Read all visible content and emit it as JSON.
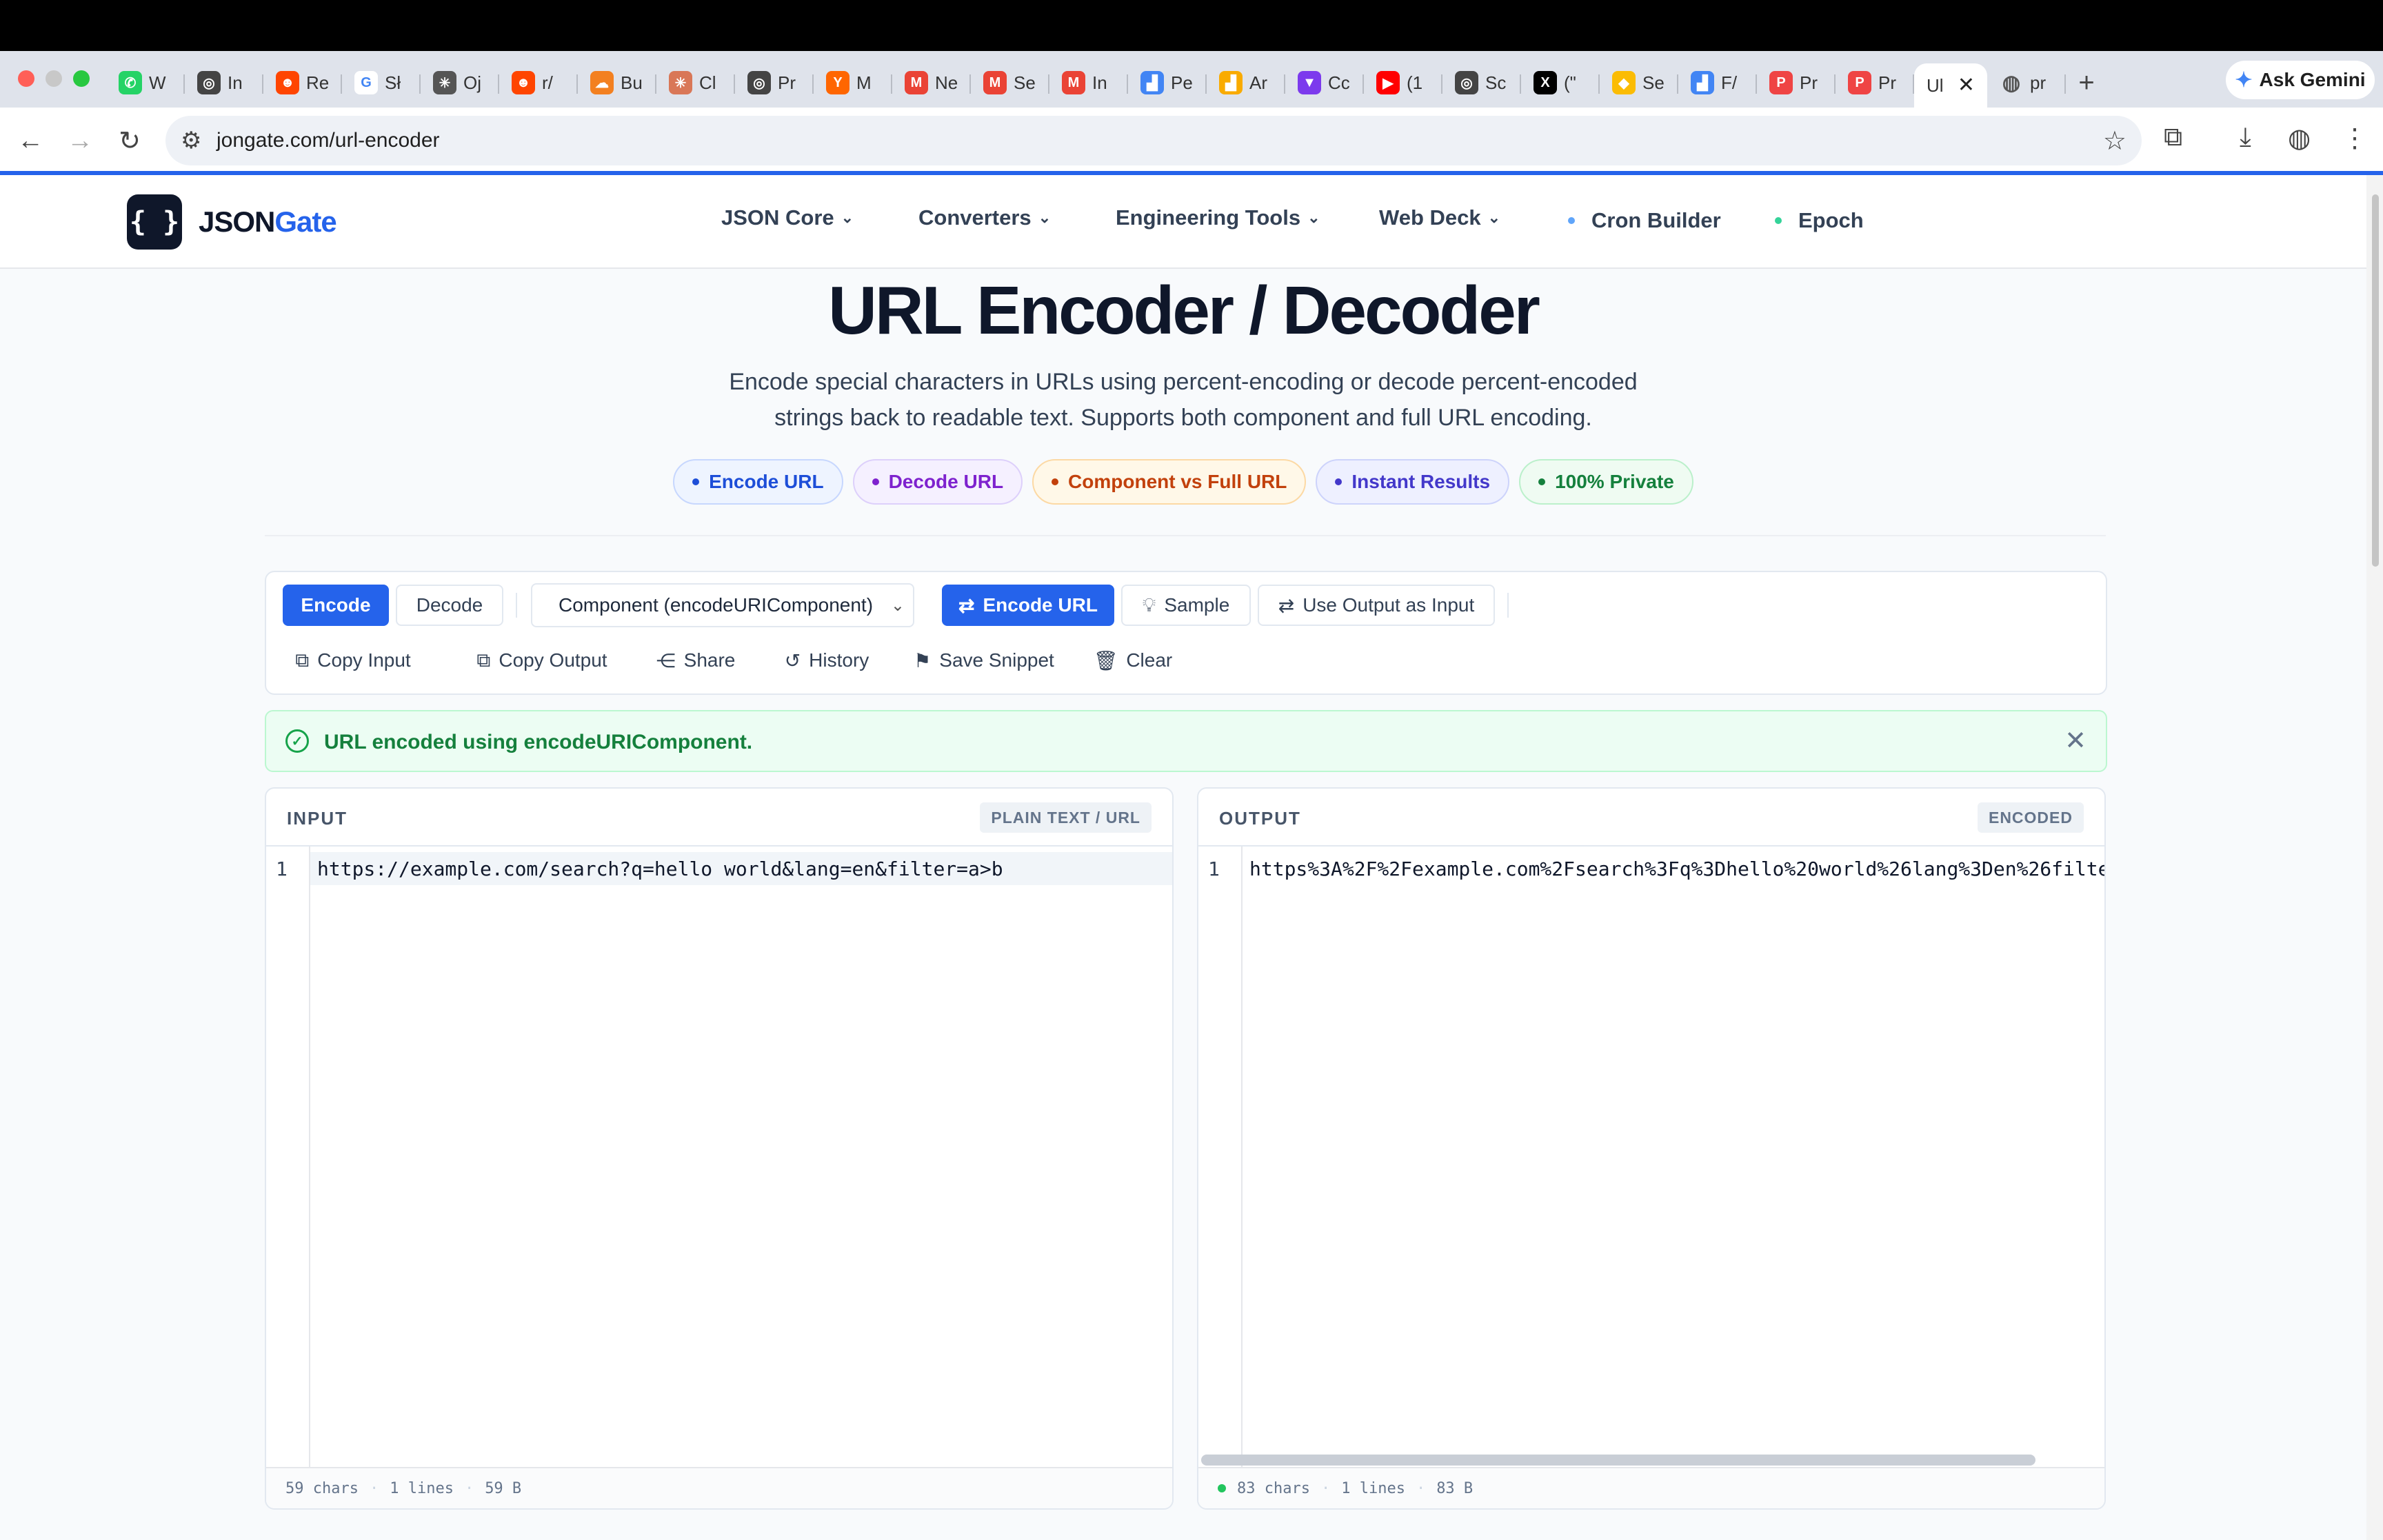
{
  "browser": {
    "tabs": [
      {
        "label": "W",
        "icon": "whatsapp-icon",
        "color": "#25d366",
        "glyph": "✆"
      },
      {
        "label": "In",
        "icon": "openai-icon",
        "color": "#444444",
        "glyph": "◎"
      },
      {
        "label": "Re",
        "icon": "reddit-icon",
        "color": "#ff4500",
        "glyph": "☻"
      },
      {
        "label": "Sł",
        "icon": "google-icon",
        "color": "#ffffff",
        "glyph": "G"
      },
      {
        "label": "Oj",
        "icon": "perplexity-icon",
        "color": "#555555",
        "glyph": "✳"
      },
      {
        "label": "r/",
        "icon": "reddit-icon",
        "color": "#ff4500",
        "glyph": "☻"
      },
      {
        "label": "Bu",
        "icon": "cloudflare-icon",
        "color": "#f38020",
        "glyph": "☁"
      },
      {
        "label": "Cl",
        "icon": "claude-icon",
        "color": "#d97757",
        "glyph": "✳"
      },
      {
        "label": "Pr",
        "icon": "openai-icon",
        "color": "#444444",
        "glyph": "◎"
      },
      {
        "label": "M",
        "icon": "ycombinator-icon",
        "color": "#ff6600",
        "glyph": "Y"
      },
      {
        "label": "Ne",
        "icon": "gmail-icon",
        "color": "#ea4335",
        "glyph": "M"
      },
      {
        "label": "Se",
        "icon": "gmail-icon",
        "color": "#ea4335",
        "glyph": "M"
      },
      {
        "label": "In",
        "icon": "gmail-icon",
        "color": "#ea4335",
        "glyph": "M"
      },
      {
        "label": "Pe",
        "icon": "analytics-icon",
        "color": "#4285f4",
        "glyph": "▟"
      },
      {
        "label": "Ar",
        "icon": "analytics-icon",
        "color": "#f9ab00",
        "glyph": "▟"
      },
      {
        "label": "Cc",
        "icon": "vite-icon",
        "color": "#7c3aed",
        "glyph": "▼"
      },
      {
        "label": "(1",
        "icon": "youtube-icon",
        "color": "#ff0000",
        "glyph": "▶"
      },
      {
        "label": "Sc",
        "icon": "openai-icon",
        "color": "#444444",
        "glyph": "◎"
      },
      {
        "label": "(\"",
        "icon": "x-icon",
        "color": "#000000",
        "glyph": "X"
      },
      {
        "label": "Se",
        "icon": "search-console-icon",
        "color": "#fbbc04",
        "glyph": "◆"
      },
      {
        "label": "F/",
        "icon": "analytics-icon",
        "color": "#4285f4",
        "glyph": "▟"
      },
      {
        "label": "Pr",
        "icon": "producthunt-icon",
        "color": "#ef4444",
        "glyph": "P"
      },
      {
        "label": "Pr",
        "icon": "producthunt-icon",
        "color": "#ef4444",
        "glyph": "P"
      }
    ],
    "active_tab": {
      "label": "Ul"
    },
    "after_tab": {
      "label": "pr",
      "icon": "globe-icon"
    },
    "ask_gemini": "Ask Gemini",
    "url": "jongate.com/url-encoder"
  },
  "site": {
    "logo_glyph": "{ }",
    "logo_json": "JSON",
    "logo_gate": "Gate",
    "nav": [
      {
        "label": "JSON Core"
      },
      {
        "label": "Converters"
      },
      {
        "label": "Engineering Tools"
      },
      {
        "label": "Web Deck"
      }
    ],
    "nav_links": [
      {
        "label": "Cron Builder",
        "dot_color": "#60a5fa"
      },
      {
        "label": "Epoch",
        "dot_color": "#34d399"
      }
    ]
  },
  "hero": {
    "title": "URL Encoder / Decoder",
    "subtitle": "Encode special characters in URLs using percent-encoding or decode percent-encoded strings back to readable text. Supports both component and full URL encoding.",
    "pills": [
      {
        "label": "Encode URL",
        "bg": "#eef4ff",
        "border": "#c7d7fe",
        "color": "#1d4ed8"
      },
      {
        "label": "Decode URL",
        "bg": "#f5f0ff",
        "border": "#ddd0fb",
        "color": "#7e22ce"
      },
      {
        "label": "Component vs Full URL",
        "bg": "#fff8e8",
        "border": "#fcd9a4",
        "color": "#c2410c"
      },
      {
        "label": "Instant Results",
        "bg": "#eef0ff",
        "border": "#cdd3fb",
        "color": "#4338ca"
      },
      {
        "label": "100% Private",
        "bg": "#effbf2",
        "border": "#bbf0cb",
        "color": "#15803d"
      }
    ]
  },
  "toolbar": {
    "encode": "Encode",
    "decode": "Decode",
    "mode": "Component (encodeURIComponent)",
    "action": "Encode URL",
    "sample": "Sample",
    "use_output": "Use Output as Input",
    "copy_input": "Copy Input",
    "copy_output": "Copy Output",
    "share": "Share",
    "history": "History",
    "save_snippet": "Save Snippet",
    "clear": "Clear"
  },
  "alert": {
    "message": "URL encoded using encodeURIComponent."
  },
  "input": {
    "title": "INPUT",
    "tag": "PLAIN TEXT / URL",
    "line_number": "1",
    "value": "https://example.com/search?q=hello world&lang=en&filter=a>b",
    "chars": "59 chars",
    "lines": "1 lines",
    "bytes": "59 B"
  },
  "output": {
    "title": "OUTPUT",
    "tag": "ENCODED",
    "line_number": "1",
    "value": "https%3A%2F%2Fexample.com%2Fsearch%3Fq%3Dhello%20world%26lang%3Den%26filte",
    "chars": "83 chars",
    "lines": "1 lines",
    "bytes": "83 B"
  }
}
